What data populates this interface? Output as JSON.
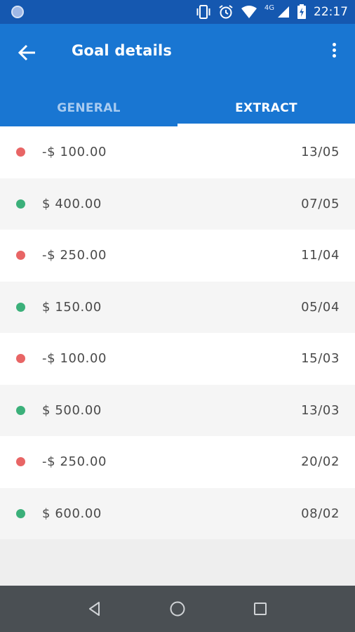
{
  "status_bar": {
    "network_label": "4G",
    "time": "22:17"
  },
  "app_bar": {
    "title": "Goal details"
  },
  "tabs": [
    {
      "label": "GENERAL",
      "active": false
    },
    {
      "label": "EXTRACT",
      "active": true
    }
  ],
  "colors": {
    "primary": "#1976d2",
    "status_bar": "#1558b0",
    "negative": "#e86565",
    "positive": "#3bb07a"
  },
  "transactions": [
    {
      "amount": "-$ 100.00",
      "date": "13/05",
      "type": "negative"
    },
    {
      "amount": "$ 400.00",
      "date": "07/05",
      "type": "positive"
    },
    {
      "amount": "-$ 250.00",
      "date": "11/04",
      "type": "negative"
    },
    {
      "amount": "$ 150.00",
      "date": "05/04",
      "type": "positive"
    },
    {
      "amount": "-$ 100.00",
      "date": "15/03",
      "type": "negative"
    },
    {
      "amount": "$ 500.00",
      "date": "13/03",
      "type": "positive"
    },
    {
      "amount": "-$ 250.00",
      "date": "20/02",
      "type": "negative"
    },
    {
      "amount": "$ 600.00",
      "date": "08/02",
      "type": "positive"
    }
  ],
  "icons": {
    "back": "arrow-left-icon",
    "more": "more-vertical-icon",
    "nav_back": "triangle-back-icon",
    "nav_home": "circle-home-icon",
    "nav_recents": "square-recents-icon"
  }
}
